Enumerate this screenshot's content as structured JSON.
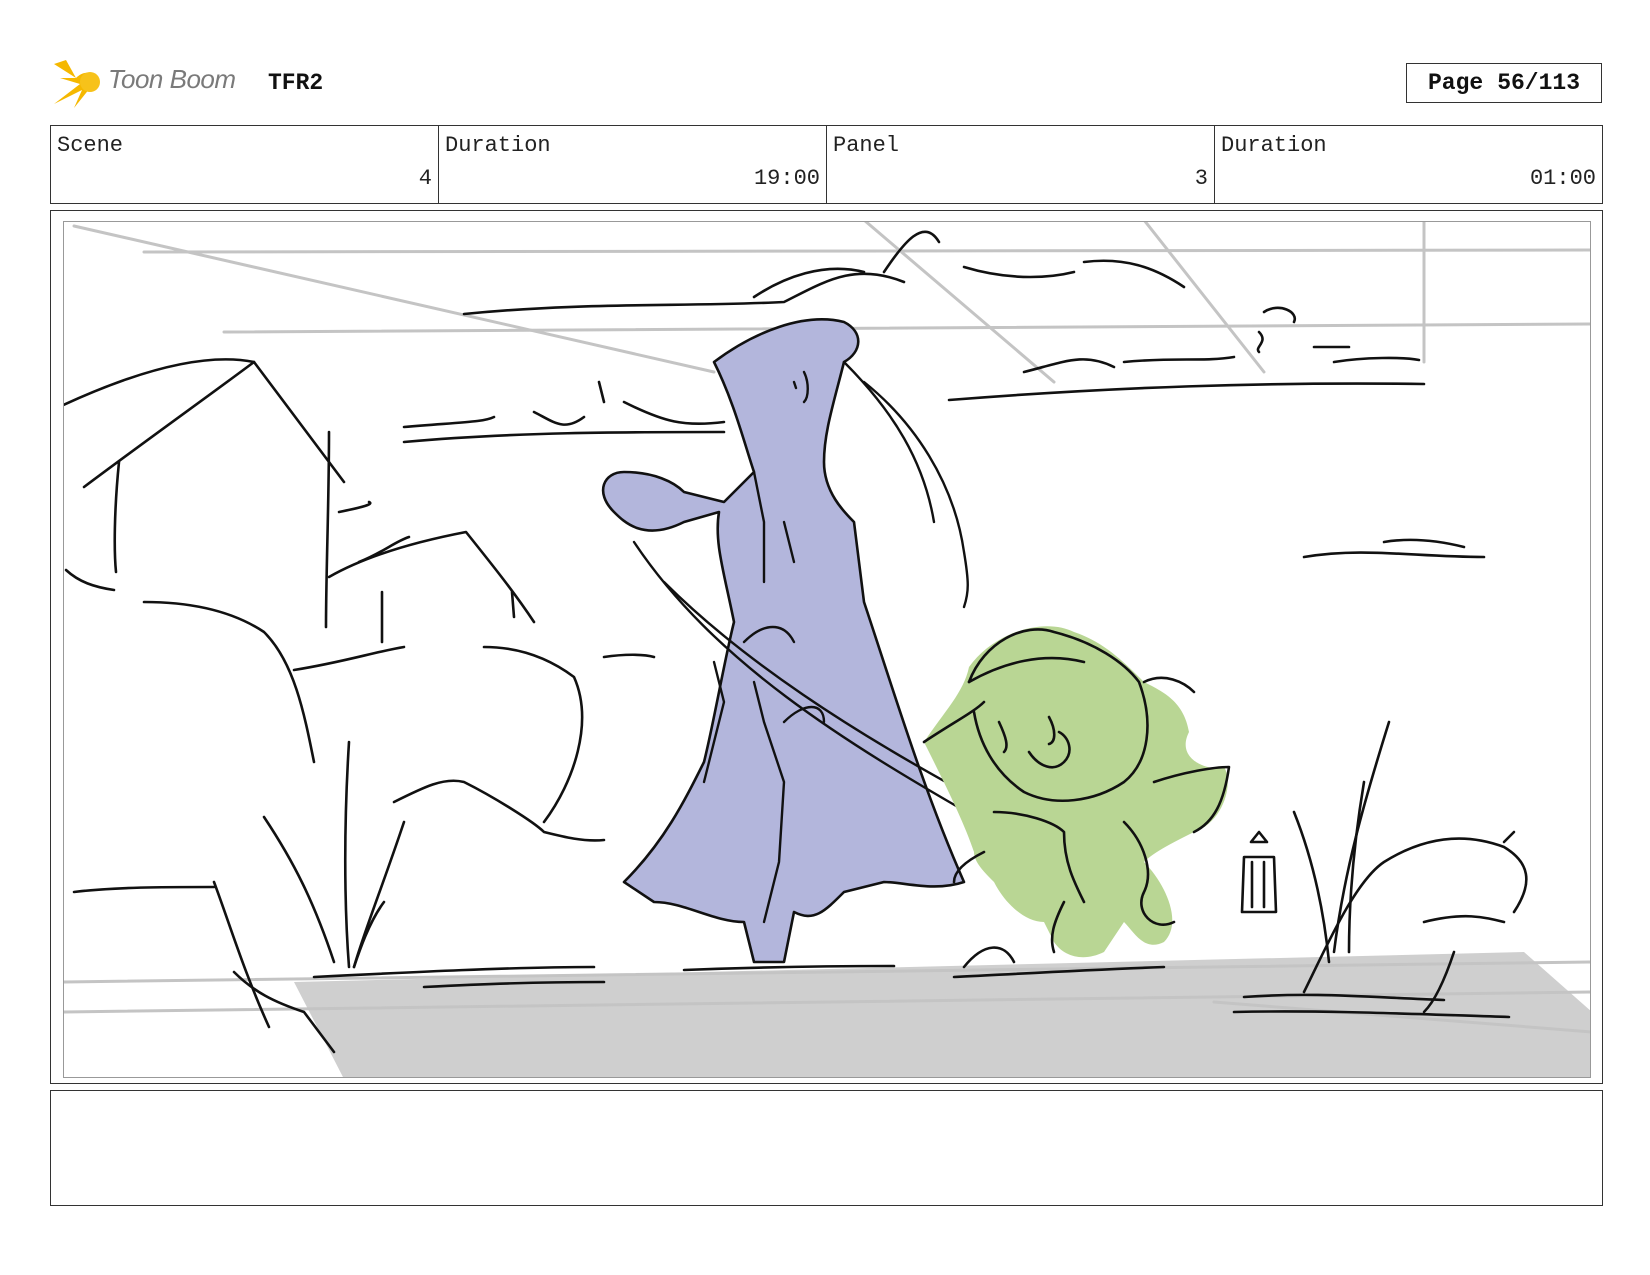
{
  "header": {
    "logo_text": "Toon Boom",
    "project": "TFR2",
    "page_label": "Page",
    "page_value": "56/113"
  },
  "info": {
    "scene_label": "Scene",
    "scene_value": "4",
    "scene_duration_label": "Duration",
    "scene_duration_value": "19:00",
    "panel_label": "Panel",
    "panel_value": "3",
    "panel_duration_label": "Duration",
    "panel_duration_value": "01:00"
  },
  "colors": {
    "logo_star": "#f5b800",
    "hero_fill": "#b3b6dc",
    "creature_fill": "#b9d694",
    "ground_fill": "#cfcfcf",
    "guide_lines": "#c4c4c4"
  },
  "caption": ""
}
